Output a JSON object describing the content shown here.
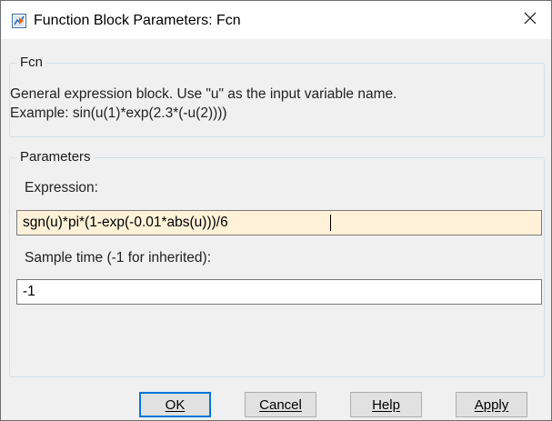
{
  "window": {
    "title": "Function Block Parameters: Fcn",
    "icon": "simulink-block-icon",
    "close_icon": "close-icon"
  },
  "block_group": {
    "legend": "Fcn",
    "description_line1": "General expression block. Use \"u\" as the input variable name.",
    "description_line2": "Example: sin(u(1)*exp(2.3*(-u(2))))"
  },
  "parameters_group": {
    "legend": "Parameters",
    "expression_label": "Expression:",
    "expression_value": "sgn(u)*pi*(1-exp(-0.01*abs(u)))/6",
    "sample_time_label": "Sample time (-1 for inherited):",
    "sample_time_value": "-1"
  },
  "buttons": {
    "ok": "OK",
    "cancel": "Cancel",
    "help": "Help",
    "apply": "Apply"
  },
  "colors": {
    "focused_field_bg": "#fff2d8",
    "default_button_border": "#0078d7"
  }
}
